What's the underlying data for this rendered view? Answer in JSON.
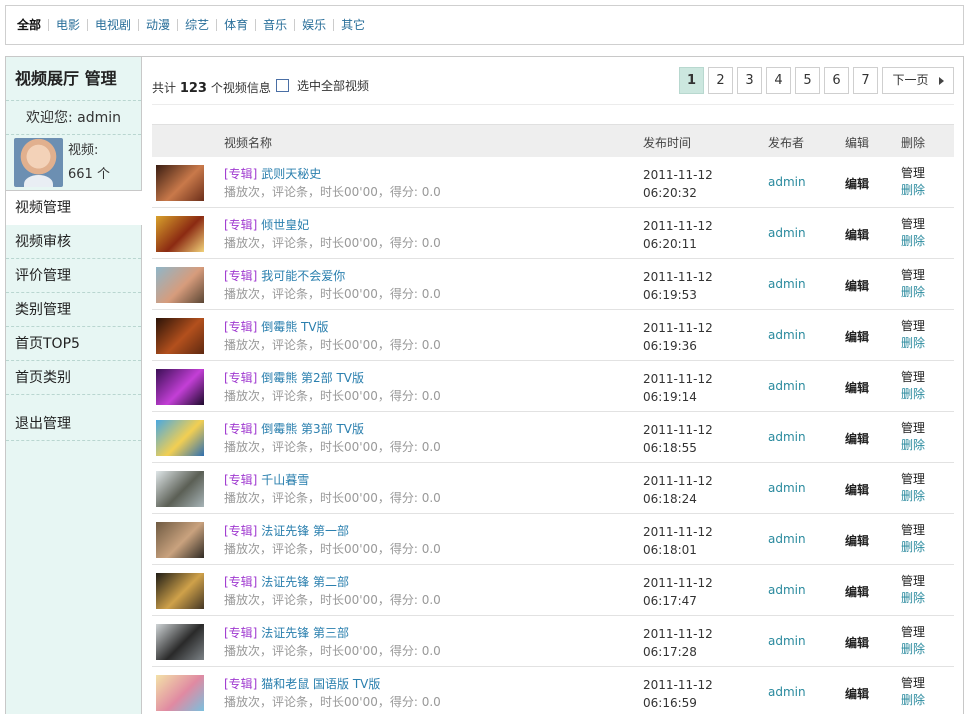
{
  "categories": [
    "全部",
    "电影",
    "电视剧",
    "动漫",
    "综艺",
    "体育",
    "音乐",
    "娱乐",
    "其它"
  ],
  "sidebar": {
    "title": "视频展厅 管理",
    "welcome": "欢迎您: admin",
    "video_label": "视频:",
    "video_count": "661 个",
    "menu": [
      "视频管理",
      "视频审核",
      "评价管理",
      "类别管理",
      "首页TOP5",
      "首页类别"
    ],
    "logout": "退出管理"
  },
  "summary": {
    "prefix": "共计",
    "count": "123",
    "suffix": "个视频信息",
    "select_all": "选中全部视频"
  },
  "pagination": {
    "pages": [
      "1",
      "2",
      "3",
      "4",
      "5",
      "6",
      "7"
    ],
    "current": "1",
    "next": "下一页"
  },
  "table": {
    "headers": {
      "name": "视频名称",
      "time": "发布时间",
      "publisher": "发布者",
      "edit": "编辑",
      "delete": "删除"
    },
    "rows": [
      {
        "tag": "[专辑]",
        "title": "武则天秘史",
        "meta": "播放次，评论条，时长00'00，得分: 0.0",
        "date": "2011-11-12",
        "time": "06:20:32",
        "publisher": "admin",
        "edit": "编辑",
        "manage": "管理",
        "delete": "删除",
        "thumb": [
          "#3a1d12",
          "#c9794a",
          "#6b2e1a"
        ]
      },
      {
        "tag": "[专辑]",
        "title": "倾世皇妃",
        "meta": "播放次，评论条，时长00'00，得分: 0.0",
        "date": "2011-11-12",
        "time": "06:20:11",
        "publisher": "admin",
        "edit": "编辑",
        "manage": "管理",
        "delete": "删除",
        "thumb": [
          "#d8a12c",
          "#8b2a12",
          "#f1d27a"
        ]
      },
      {
        "tag": "[专辑]",
        "title": "我可能不会爱你",
        "meta": "播放次，评论条，时长00'00，得分: 0.0",
        "date": "2011-11-12",
        "time": "06:19:53",
        "publisher": "admin",
        "edit": "编辑",
        "manage": "管理",
        "delete": "删除",
        "thumb": [
          "#8fb6c9",
          "#d79c7c",
          "#5a4634"
        ]
      },
      {
        "tag": "[专辑]",
        "title": "倒霉熊 TV版",
        "meta": "播放次，评论条，时长00'00，得分: 0.0",
        "date": "2011-11-12",
        "time": "06:19:36",
        "publisher": "admin",
        "edit": "编辑",
        "manage": "管理",
        "delete": "删除",
        "thumb": [
          "#2b1308",
          "#b3501d",
          "#5e2810"
        ]
      },
      {
        "tag": "[专辑]",
        "title": "倒霉熊 第2部 TV版",
        "meta": "播放次，评论条，时长00'00，得分: 0.0",
        "date": "2011-11-12",
        "time": "06:19:14",
        "publisher": "admin",
        "edit": "编辑",
        "manage": "管理",
        "delete": "删除",
        "thumb": [
          "#3b0f55",
          "#c33fd6",
          "#1d0a2c"
        ]
      },
      {
        "tag": "[专辑]",
        "title": "倒霉熊 第3部 TV版",
        "meta": "播放次，评论条，时长00'00，得分: 0.0",
        "date": "2011-11-12",
        "time": "06:18:55",
        "publisher": "admin",
        "edit": "编辑",
        "manage": "管理",
        "delete": "删除",
        "thumb": [
          "#4aa8e0",
          "#f2cf52",
          "#2f6fb0"
        ]
      },
      {
        "tag": "[专辑]",
        "title": "千山暮雪",
        "meta": "播放次，评论条，时长00'00，得分: 0.0",
        "date": "2011-11-12",
        "time": "06:18:24",
        "publisher": "admin",
        "edit": "编辑",
        "manage": "管理",
        "delete": "删除",
        "thumb": [
          "#dfe6e8",
          "#5b5f55",
          "#a7b4b7"
        ]
      },
      {
        "tag": "[专辑]",
        "title": "法证先锋 第一部",
        "meta": "播放次，评论条，时长00'00，得分: 0.0",
        "date": "2011-11-12",
        "time": "06:18:01",
        "publisher": "admin",
        "edit": "编辑",
        "manage": "管理",
        "delete": "删除",
        "thumb": [
          "#6e5a42",
          "#c9a27e",
          "#2f2a24"
        ]
      },
      {
        "tag": "[专辑]",
        "title": "法证先锋 第二部",
        "meta": "播放次，评论条，时长00'00，得分: 0.0",
        "date": "2011-11-12",
        "time": "06:17:47",
        "publisher": "admin",
        "edit": "编辑",
        "manage": "管理",
        "delete": "删除",
        "thumb": [
          "#1e1c16",
          "#cfa14a",
          "#433624"
        ]
      },
      {
        "tag": "[专辑]",
        "title": "法证先锋 第三部",
        "meta": "播放次，评论条，时长00'00，得分: 0.0",
        "date": "2011-11-12",
        "time": "06:17:28",
        "publisher": "admin",
        "edit": "编辑",
        "manage": "管理",
        "delete": "删除",
        "thumb": [
          "#cfd4d6",
          "#2a2a2a",
          "#7c8286"
        ]
      },
      {
        "tag": "[专辑]",
        "title": "猫和老鼠 国语版 TV版",
        "meta": "播放次，评论条，时长00'00，得分: 0.0",
        "date": "2011-11-12",
        "time": "06:16:59",
        "publisher": "admin",
        "edit": "编辑",
        "manage": "管理",
        "delete": "删除",
        "thumb": [
          "#f3e2a8",
          "#e08aa2",
          "#7ac0de"
        ]
      }
    ]
  }
}
